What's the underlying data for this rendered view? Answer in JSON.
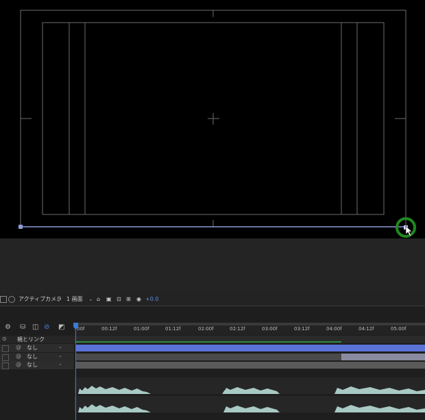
{
  "viewer": {
    "background": "#000000",
    "guide_color": "#7a7a7a",
    "selection_color": "#8f9bd8",
    "highlight_circle_color": "#1f8a1f"
  },
  "toolbar": {
    "view_menu_label": "アクティブカメラ",
    "view_count_label": "1 画面",
    "exposure_value": "+0.0"
  },
  "timeline": {
    "ruler_labels": [
      "00f",
      "00:12f",
      "01:00f",
      "01:12f",
      "02:00f",
      "02:12f",
      "03:00f",
      "03:12f",
      "04:00f",
      "04:12f",
      "05:00f"
    ],
    "header_label": "親とリンク",
    "layers": [
      {
        "parent": "なし",
        "bar_color": "#5b72d6"
      },
      {
        "parent": "なし",
        "bar_color": "#4a4a4a"
      },
      {
        "parent": "なし",
        "bar_color": "#5a5a5a"
      }
    ],
    "accent_color": "#3a7bd5",
    "work_area_color": "#2e8b3e",
    "waveform_color": "#a9c9c4"
  }
}
